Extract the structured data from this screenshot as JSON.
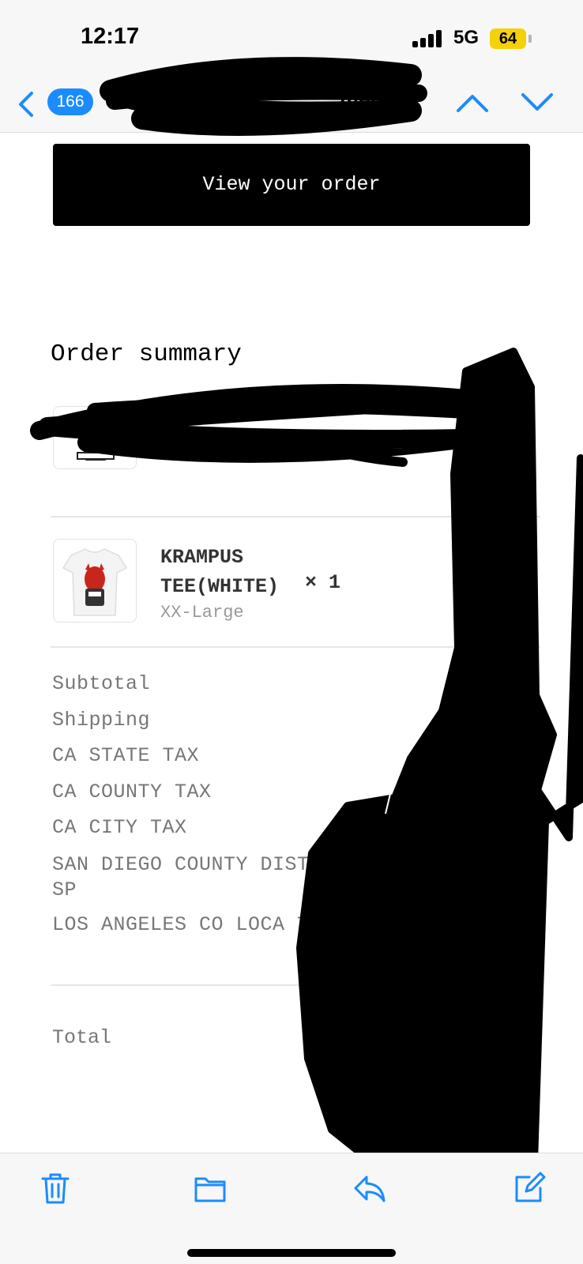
{
  "status_bar": {
    "time": "12:17",
    "network": "5G",
    "battery": "64",
    "battery_color": "#f5d10a"
  },
  "nav": {
    "back_count": "166",
    "title_fragment": "med",
    "accent_color": "#1a8cff",
    "icons": [
      "chevron-left-icon",
      "chevron-up-icon",
      "chevron-down-icon"
    ]
  },
  "email": {
    "view_order_button": "View your order",
    "order_summary_heading": "Order summary",
    "items": [
      {
        "name": "KRAMPUS TEE(WHITE)",
        "quantity": "× 1",
        "variant": "XX-Large"
      }
    ],
    "line_items": [
      "Subtotal",
      "Shipping",
      "CA STATE TAX",
      "CA COUNTY TAX",
      "CA CITY TAX",
      "SAN DIEGO COUNTY DISTRIC SP",
      "LOS ANGELES CO LOCA TAX"
    ],
    "total_label": "Total",
    "total_value": "$"
  },
  "toolbar": {
    "icons": [
      "trash-icon",
      "folder-icon",
      "reply-icon",
      "compose-icon"
    ]
  }
}
